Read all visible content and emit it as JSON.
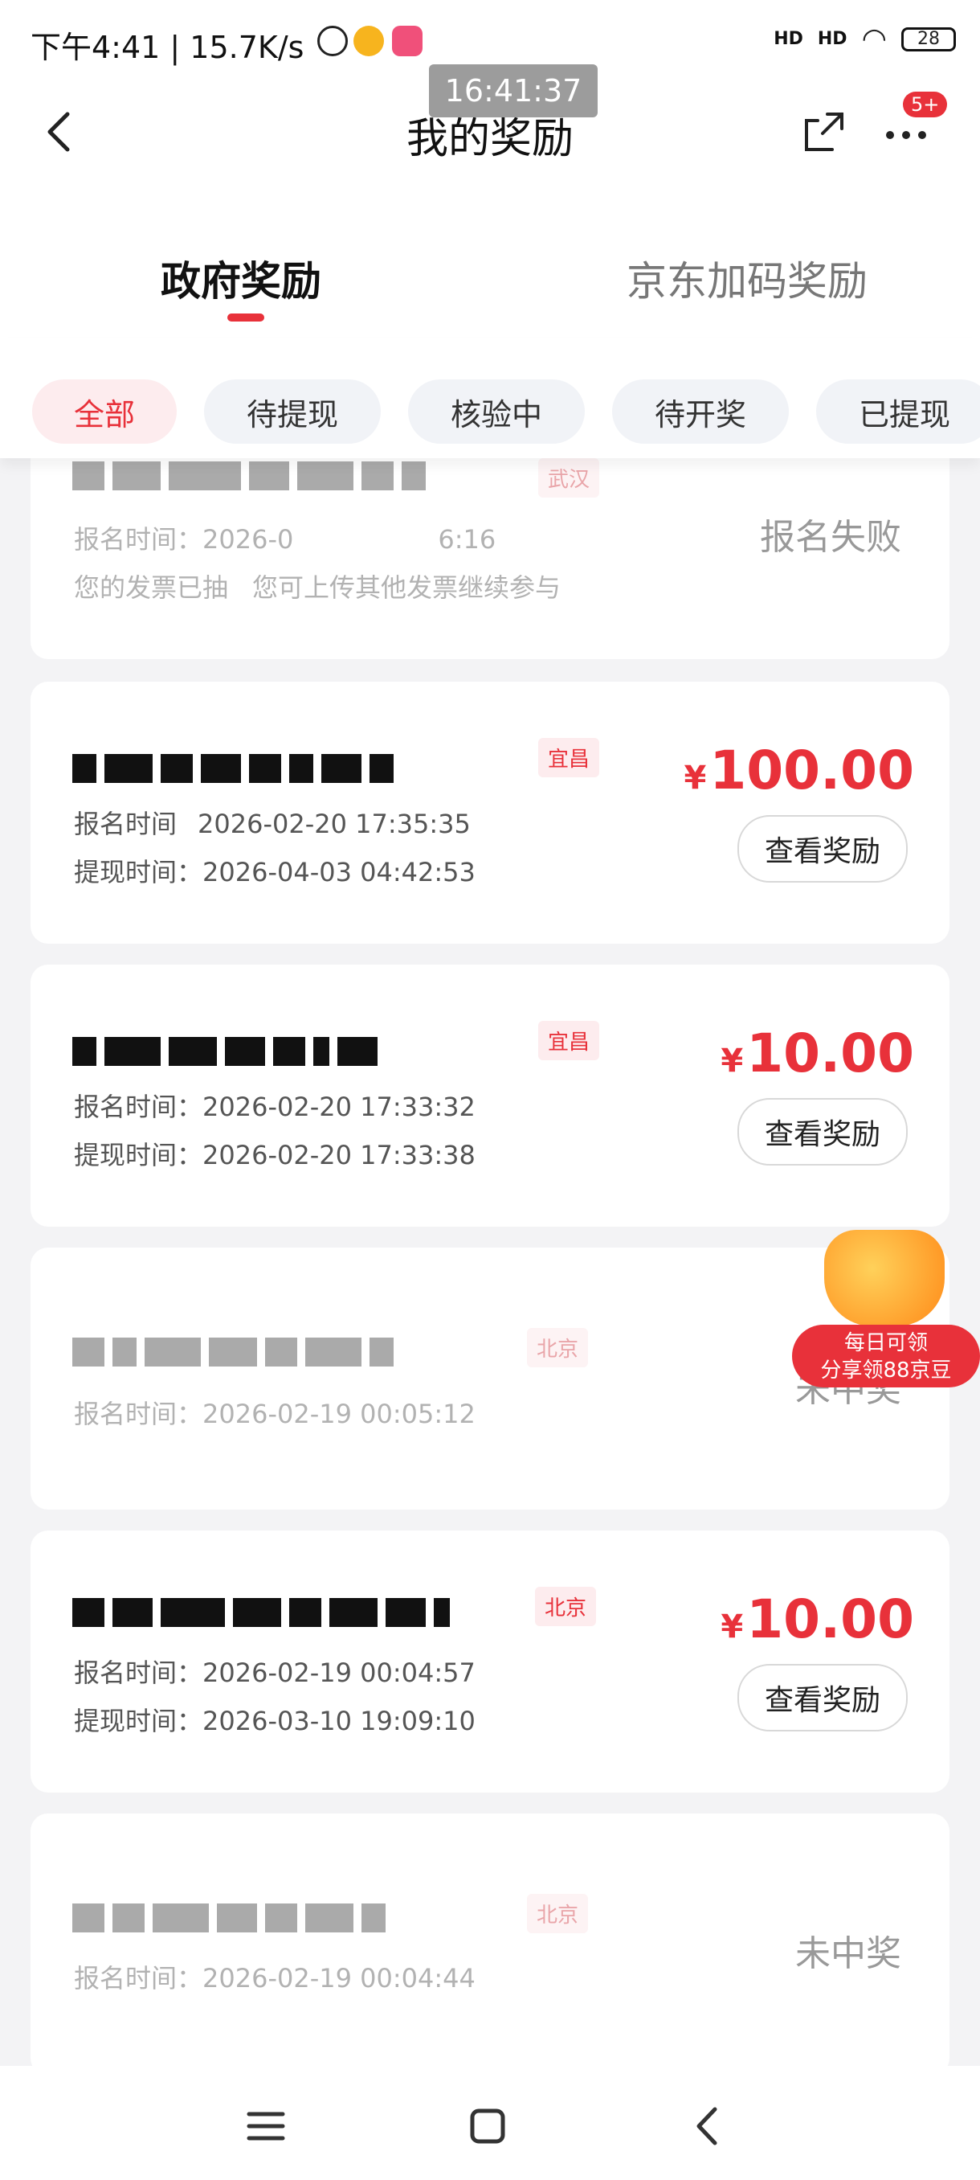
{
  "status_bar": {
    "time_speed": "下午4:41 | 15.7K/s",
    "signal1": "HD",
    "signal2": "HD",
    "battery": "28"
  },
  "clock_overlay": "16:41:37",
  "header": {
    "title": "我的奖励",
    "badge": "5+"
  },
  "main_tabs": [
    {
      "label": "政府奖励"
    },
    {
      "label": "京东加码奖励"
    }
  ],
  "filters": [
    {
      "label": "全部"
    },
    {
      "label": "待提现"
    },
    {
      "label": "核验中"
    },
    {
      "label": "待开奖"
    },
    {
      "label": "已提现"
    }
  ],
  "records": [
    {
      "city": "武汉",
      "signup": "报名时间：2026-0",
      "signup_tail": "6:16",
      "note": "您的发票已抽",
      "note_tail": "您可上传其他发票继续参与",
      "status": "报名失败"
    },
    {
      "city": "宜昌",
      "signup_prefix": "报名时间",
      "signup": "2026-02-20 17:35:35",
      "withdraw": "提现时间：2026-04-03 04:42:53",
      "currency": "¥",
      "amount": "100.00",
      "button": "查看奖励"
    },
    {
      "city": "宜昌",
      "signup": "报名时间：2026-02-20 17:33:32",
      "withdraw": "提现时间：2026-02-20 17:33:38",
      "currency": "¥",
      "amount": "10.00",
      "button": "查看奖励"
    },
    {
      "city": "北京",
      "signup": "报名时间：2026-02-19 00:05:12",
      "status": "未中奖"
    },
    {
      "city": "北京",
      "signup": "报名时间：2026-02-19 00:04:57",
      "withdraw": "提现时间：2026-03-10 19:09:10",
      "currency": "¥",
      "amount": "10.00",
      "button": "查看奖励"
    },
    {
      "city": "北京",
      "signup": "报名时间：2026-02-19 00:04:44",
      "status": "未中奖"
    }
  ],
  "promo": {
    "line1": "每日可领",
    "line2": "分享领88京豆"
  }
}
